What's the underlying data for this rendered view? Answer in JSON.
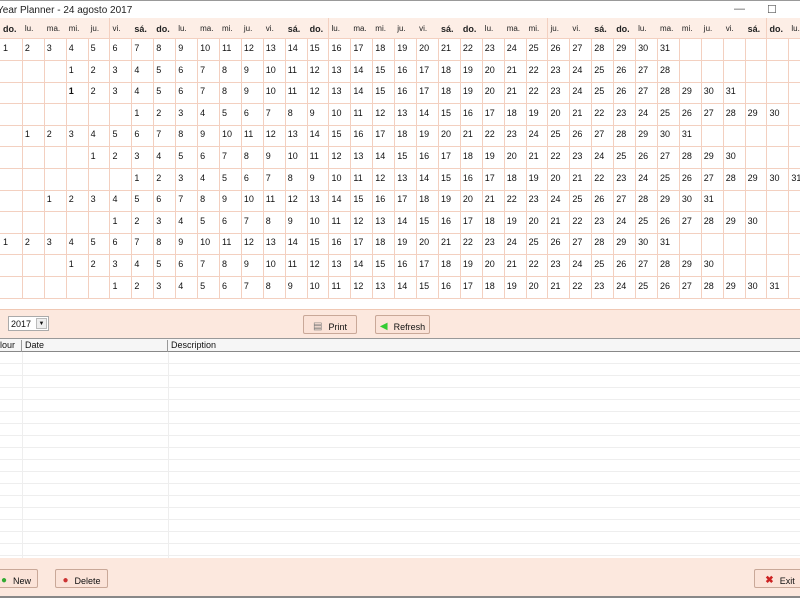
{
  "window": {
    "title": "Year Planner - 24 agosto 2017",
    "minimize": "—",
    "maximize": "☐"
  },
  "weekdays": [
    "do.",
    "lu.",
    "ma.",
    "mi.",
    "ju.",
    "vi.",
    "sá."
  ],
  "weekend": [
    "sá.",
    "do."
  ],
  "year": 2017,
  "months": [
    {
      "offset": 0,
      "days": 31
    },
    {
      "offset": 3,
      "days": 28
    },
    {
      "offset": 3,
      "days": 31,
      "bold_day": 1
    },
    {
      "offset": 6,
      "days": 30
    },
    {
      "offset": 1,
      "days": 31
    },
    {
      "offset": 4,
      "days": 30
    },
    {
      "offset": 6,
      "days": 31
    },
    {
      "offset": 2,
      "days": 31
    },
    {
      "offset": 5,
      "days": 30
    },
    {
      "offset": 0,
      "days": 31
    },
    {
      "offset": 3,
      "days": 30
    },
    {
      "offset": 5,
      "days": 31
    }
  ],
  "toolbar": {
    "year_value": "2017",
    "print": "Print",
    "refresh": "Refresh"
  },
  "list": {
    "columns": [
      "lour",
      "Date",
      "Description"
    ],
    "rows": []
  },
  "footer": {
    "new": "New",
    "delete": "Delete",
    "exit": "Exit"
  },
  "colors": {
    "header_bg": "#fdeee6",
    "grid_line": "#f3d0c0",
    "panel_bg": "#fce8de"
  }
}
